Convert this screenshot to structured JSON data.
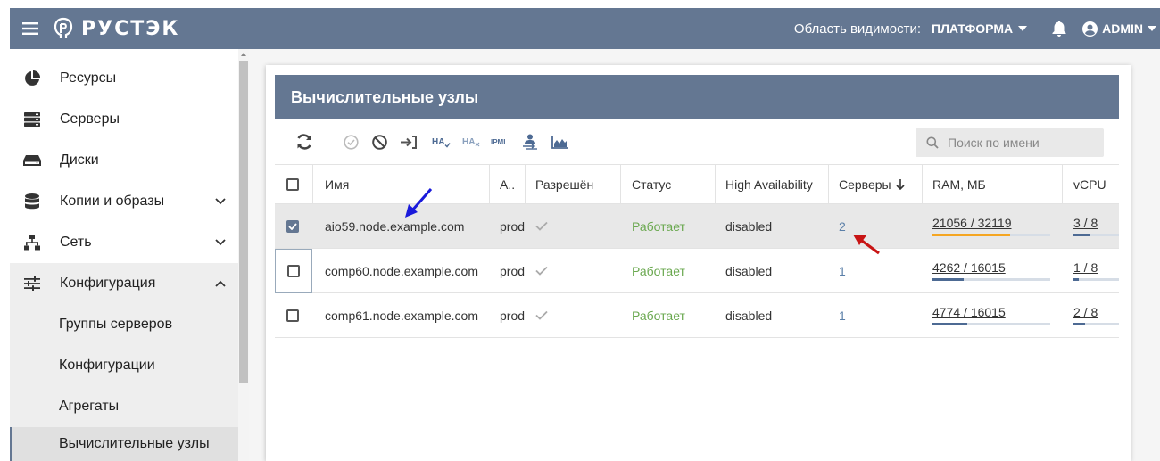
{
  "topbar": {
    "logo_text": "РУСТЭК",
    "scope_label": "Область видимости:",
    "scope_value": "ПЛАТФОРМА",
    "user_label": "ADMIN"
  },
  "sidebar": {
    "items": [
      {
        "label": "Ресурсы",
        "icon": "pie-chart-icon"
      },
      {
        "label": "Серверы",
        "icon": "server-icon"
      },
      {
        "label": "Диски",
        "icon": "disk-icon"
      },
      {
        "label": "Копии и образы",
        "icon": "database-icon"
      },
      {
        "label": "Сеть",
        "icon": "network-icon"
      },
      {
        "label": "Конфигурация",
        "icon": "sliders-icon"
      }
    ],
    "sub_items": [
      {
        "label": "Группы серверов"
      },
      {
        "label": "Конфигурации"
      },
      {
        "label": "Агрегаты"
      },
      {
        "label": "Вычислительные узлы"
      }
    ]
  },
  "panel": {
    "title": "Вычислительные узлы",
    "search_placeholder": "Поиск по имени",
    "toolbar_labels": {
      "ha1": "HA",
      "ha2": "HA",
      "ipmi": "IPMI"
    }
  },
  "table": {
    "columns": {
      "name": "Имя",
      "a": "А..",
      "allowed": "Разрешён",
      "status": "Статус",
      "ha": "High Availability",
      "servers": "Серверы",
      "ram": "RAM, МБ",
      "vcpu": "vCPU"
    },
    "rows": [
      {
        "name": "aio59.node.example.com",
        "a": "prod",
        "status": "Работает",
        "ha": "disabled",
        "servers": "2",
        "ram_text": "21056 / 32119",
        "ram_used": 21056,
        "ram_total": 32119,
        "vcpu_text": "3 / 8",
        "vcpu_used": 3,
        "vcpu_total": 8,
        "selected": true
      },
      {
        "name": "comp60.node.example.com",
        "a": "prod",
        "status": "Работает",
        "ha": "disabled",
        "servers": "1",
        "ram_text": "4262 / 16015",
        "ram_used": 4262,
        "ram_total": 16015,
        "vcpu_text": "1 / 8",
        "vcpu_used": 1,
        "vcpu_total": 8,
        "selected": false
      },
      {
        "name": "comp61.node.example.com",
        "a": "prod",
        "status": "Работает",
        "ha": "disabled",
        "servers": "1",
        "ram_text": "4774 / 16015",
        "ram_used": 4774,
        "ram_total": 16015,
        "vcpu_text": "2 / 8",
        "vcpu_used": 2,
        "vcpu_total": 8,
        "selected": false
      }
    ]
  },
  "colors": {
    "brand": "#647792",
    "status_ok": "#6aa84f",
    "bar_high": "#f5a623",
    "bar_normal": "#4d6a93",
    "annotation_blue": "#1a1adb",
    "annotation_red": "#c81414"
  }
}
